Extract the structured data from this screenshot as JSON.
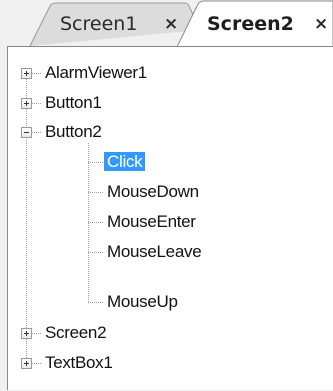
{
  "tabs": [
    {
      "label": "Screen1",
      "close": "×",
      "active": false
    },
    {
      "label": "Screen2",
      "close": "×",
      "active": true
    }
  ],
  "tree": {
    "nodes": [
      {
        "label": "AlarmViewer1",
        "state": "collapsed"
      },
      {
        "label": "Button1",
        "state": "collapsed"
      },
      {
        "label": "Button2",
        "state": "expanded",
        "children": [
          {
            "label": "Click",
            "selected": true
          },
          {
            "label": "MouseDown"
          },
          {
            "label": "MouseEnter"
          },
          {
            "label": "MouseLeave"
          },
          {
            "label": "MouseUp"
          }
        ]
      },
      {
        "label": "Screen2",
        "state": "collapsed"
      },
      {
        "label": "TextBox1",
        "state": "collapsed"
      }
    ]
  },
  "colors": {
    "selection": "#3399ff",
    "border": "#828790",
    "background": "#f0f0f0"
  }
}
